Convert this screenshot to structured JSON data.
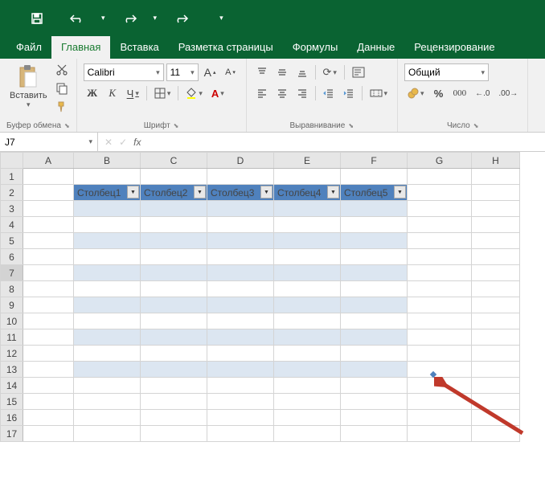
{
  "qat": {
    "save": "save",
    "undo": "undo",
    "redo": "redo",
    "redo2": "redo"
  },
  "tabs": {
    "file": "Файл",
    "home": "Главная",
    "insert": "Вставка",
    "page_layout": "Разметка страницы",
    "formulas": "Формулы",
    "data": "Данные",
    "review": "Рецензирование"
  },
  "ribbon": {
    "clipboard": {
      "paste": "Вставить",
      "group_label": "Буфер обмена"
    },
    "font": {
      "name": "Calibri",
      "size": "11",
      "bold": "Ж",
      "italic": "К",
      "underline": "Ч",
      "group_label": "Шрифт",
      "grow": "A",
      "shrink": "A"
    },
    "alignment": {
      "group_label": "Выравнивание"
    },
    "number": {
      "format": "Общий",
      "group_label": "Число"
    }
  },
  "namebox": {
    "ref": "J7"
  },
  "formula_bar": {
    "fx": "fx"
  },
  "columns": [
    "A",
    "B",
    "C",
    "D",
    "E",
    "F",
    "G",
    "H"
  ],
  "rows": [
    "1",
    "2",
    "3",
    "4",
    "5",
    "6",
    "7",
    "8",
    "9",
    "10",
    "11",
    "12",
    "13",
    "14",
    "15",
    "16",
    "17"
  ],
  "table": {
    "headers": [
      "Столбец1",
      "Столбец2",
      "Столбец3",
      "Столбец4",
      "Столбец5"
    ]
  },
  "colors": {
    "accent": "#0a6332",
    "table_header": "#4f81bd",
    "band": "#dce6f1"
  }
}
